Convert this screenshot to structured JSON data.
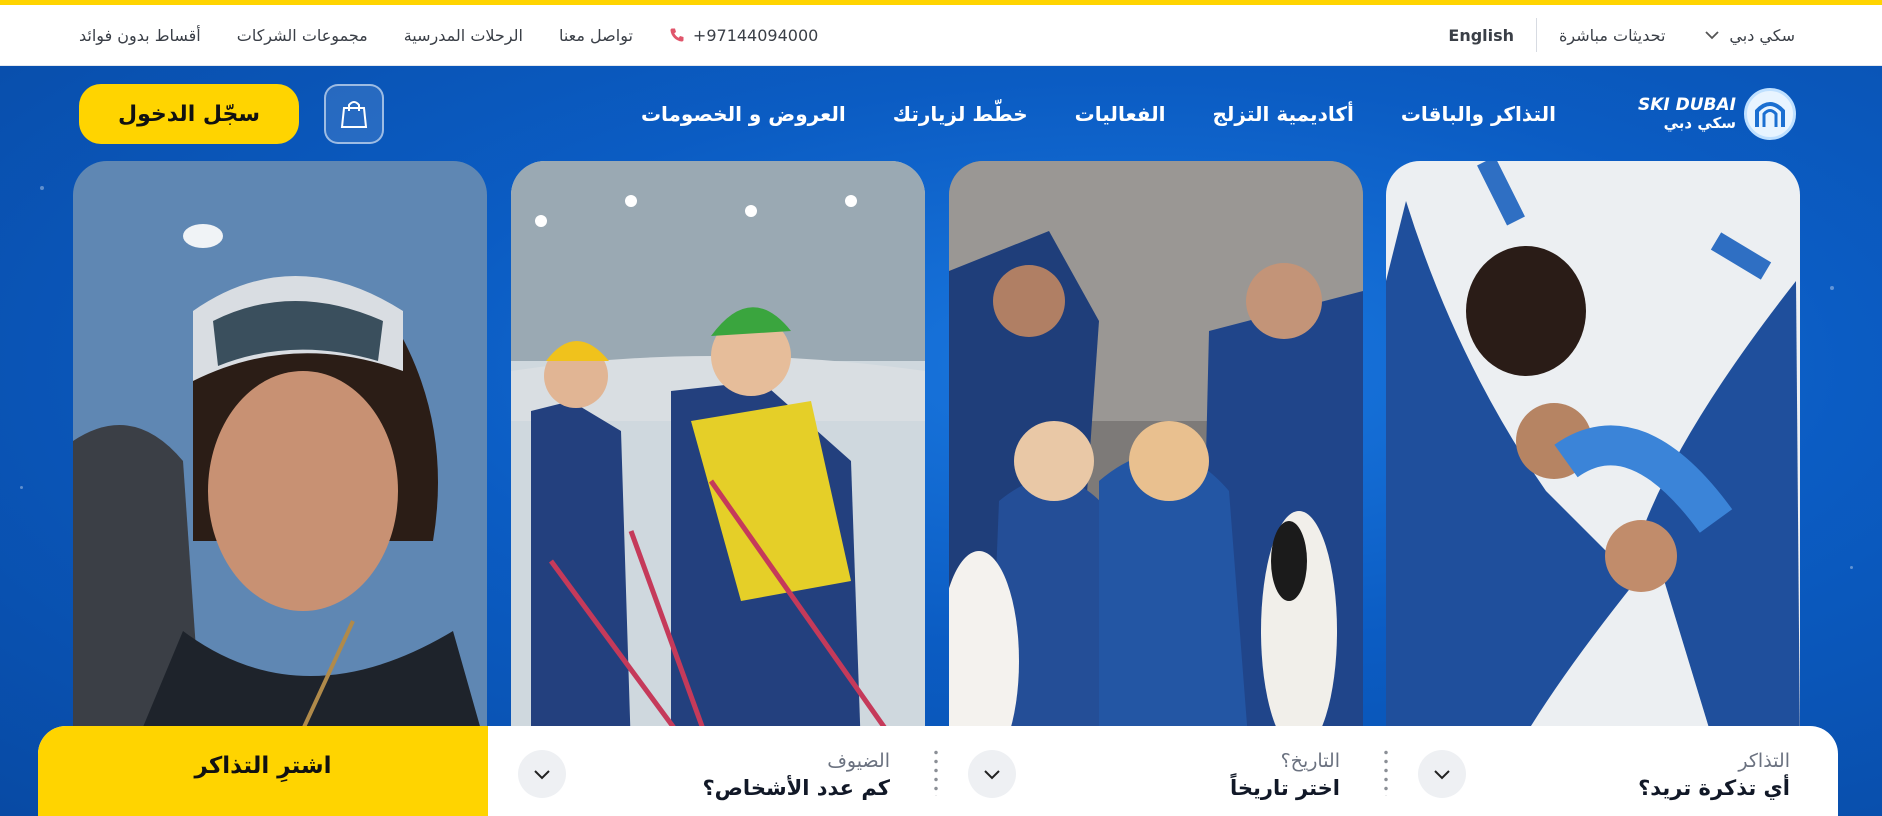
{
  "topbar": {
    "location_label": "سكي دبي",
    "live_updates": "تحديثات مباشرة",
    "language": "English",
    "links": [
      "أقساط بدون فوائد",
      "مجموعات الشركات",
      "الرحلات المدرسية",
      "تواصل معنا"
    ],
    "phone": "+97144094000"
  },
  "logo": {
    "en": "SKI DUBAI",
    "ar": "سكي دبي"
  },
  "nav": {
    "items": [
      "التذاكر والباقات",
      "أكاديمية التزلج",
      "الفعاليات",
      "خطّط لزيارتك",
      "العروض و الخصومات"
    ],
    "login": "سجّل الدخول"
  },
  "booking": {
    "fields": [
      {
        "label": "التذاكر",
        "value": "أي تذكرة تريد؟"
      },
      {
        "label": "التاريخ؟",
        "value": "اختر تاريخاً"
      },
      {
        "label": "الضيوف",
        "value": "كم عدد الأشخاص؟"
      }
    ],
    "buy": "اشترِ التذاكر"
  },
  "colors": {
    "accent": "#ffd400",
    "brand_blue": "#0b5cc3"
  }
}
